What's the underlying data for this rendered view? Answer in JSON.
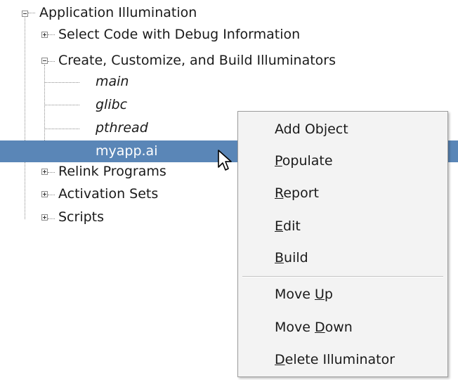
{
  "tree": {
    "root": "Application Illumination",
    "items": [
      "Select Code with Debug Information",
      "Create, Customize, and Build Illuminators",
      "Relink Programs",
      "Activation Sets",
      "Scripts"
    ],
    "illuminators": [
      "main",
      "glibc",
      "pthread",
      "myapp.ai"
    ]
  },
  "context_menu": {
    "items": [
      {
        "pre": "Add Object",
        "acc": "",
        "post": ""
      },
      {
        "pre": "",
        "acc": "P",
        "post": "opulate"
      },
      {
        "pre": "",
        "acc": "R",
        "post": "eport"
      },
      {
        "pre": "",
        "acc": "E",
        "post": "dit"
      },
      {
        "pre": "",
        "acc": "B",
        "post": "uild"
      },
      {
        "pre": "Move ",
        "acc": "U",
        "post": "p"
      },
      {
        "pre": "Move ",
        "acc": "D",
        "post": "own"
      },
      {
        "pre": "",
        "acc": "D",
        "post": "elete Illuminator"
      }
    ]
  },
  "colors": {
    "selection": "#5a86b7",
    "menu_background": "#f3f3f3"
  }
}
